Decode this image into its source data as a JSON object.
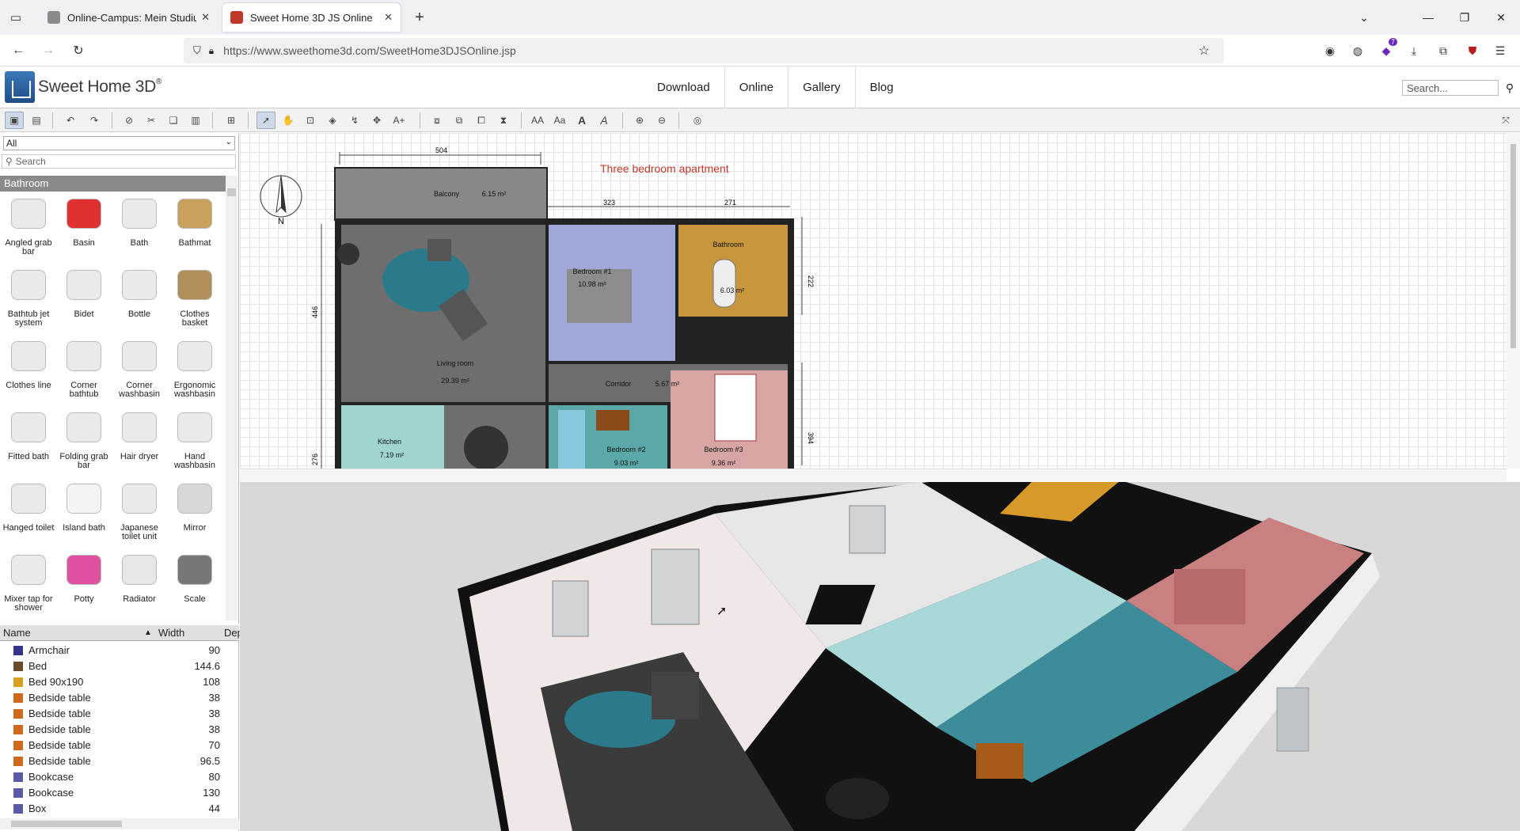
{
  "browser": {
    "tabs": [
      {
        "title": "Online-Campus: Mein Studium",
        "active": false
      },
      {
        "title": "Sweet Home 3D JS Online",
        "active": true
      }
    ],
    "url": "https://www.sweethome3d.com/SweetHome3DJSOnline.jsp",
    "extension_badge": "7"
  },
  "site": {
    "logo_text": "Sweet Home 3D",
    "logo_mark": "®",
    "nav": [
      "Download",
      "Online",
      "Gallery",
      "Blog"
    ],
    "search_placeholder": "Search..."
  },
  "catalog": {
    "filter_value": "All",
    "search_placeholder": "Search",
    "category": "Bathroom",
    "items": [
      "Angled grab bar",
      "Basin",
      "Bath",
      "Bathmat",
      "Bathtub jet system",
      "Bidet",
      "Bottle",
      "Clothes basket",
      "Clothes line",
      "Corner bathtub",
      "Corner washbasin",
      "Ergonomic washbasin",
      "Fitted bath",
      "Folding grab bar",
      "Hair dryer",
      "Hand washbasin",
      "Hanged toilet",
      "Island bath",
      "Japanese toilet unit",
      "Mirror",
      "Mixer tap for shower",
      "Potty",
      "Radiator",
      "Scale"
    ]
  },
  "furniture_table": {
    "columns": [
      "Name",
      "Width",
      "Dep"
    ],
    "rows": [
      {
        "name": "Armchair",
        "width": "90"
      },
      {
        "name": "Bed",
        "width": "144.6"
      },
      {
        "name": "Bed 90x190",
        "width": "108"
      },
      {
        "name": "Bedside table",
        "width": "38"
      },
      {
        "name": "Bedside table",
        "width": "38"
      },
      {
        "name": "Bedside table",
        "width": "38"
      },
      {
        "name": "Bedside table",
        "width": "70"
      },
      {
        "name": "Bedside table",
        "width": "96.5"
      },
      {
        "name": "Bookcase",
        "width": "80"
      },
      {
        "name": "Bookcase",
        "width": "130"
      },
      {
        "name": "Box",
        "width": "44"
      }
    ]
  },
  "plan": {
    "title": "Three bedroom apartment",
    "compass_label": "N",
    "dimensions": [
      "504",
      "323",
      "271",
      "222",
      "446",
      "394",
      "276"
    ],
    "rooms": [
      {
        "name": "Balcony",
        "area": "6.15 m²"
      },
      {
        "name": "Living room",
        "area": "29.39 m²"
      },
      {
        "name": "Bedroom #1",
        "area": "10.98 m²"
      },
      {
        "name": "Bathroom",
        "area": "6.03 m²"
      },
      {
        "name": "Corridor",
        "area": "5.67 m²"
      },
      {
        "name": "Kitchen",
        "area": "7.19 m²"
      },
      {
        "name": "Bedroom #2",
        "area": "9.03 m²"
      },
      {
        "name": "Bedroom #3",
        "area": "9.36 m²"
      }
    ]
  },
  "colors": {
    "plan_title": "#c0392b",
    "living": "#6e6e6e",
    "bedroom1": "#9fa8d8",
    "bathroom": "#c8963c",
    "kitchen": "#9fd4cf",
    "bedroom2": "#5aa8a8",
    "bedroom3": "#d8a5a5"
  }
}
